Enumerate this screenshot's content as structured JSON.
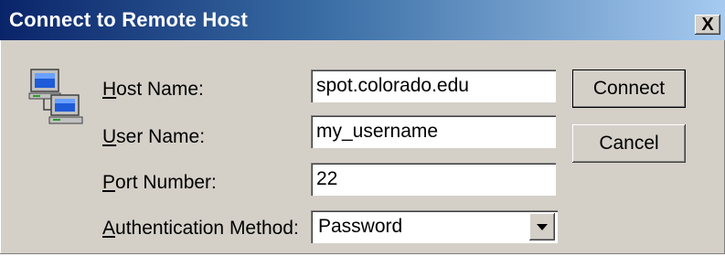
{
  "window": {
    "title": "Connect to Remote Host",
    "close_glyph": "X"
  },
  "icon": {
    "name": "network-computers-icon"
  },
  "form": {
    "host": {
      "label_accel": "H",
      "label_rest": "ost Name:",
      "value": "spot.colorado.edu"
    },
    "user": {
      "label_accel": "U",
      "label_rest": "ser Name:",
      "value": "my_username"
    },
    "port": {
      "label_accel": "P",
      "label_rest": "ort Number:",
      "value": "22"
    },
    "auth": {
      "label_accel": "A",
      "label_rest": "uthentication Method:",
      "value": "Password"
    }
  },
  "buttons": {
    "connect": "Connect",
    "cancel": "Cancel"
  },
  "colors": {
    "titlebar_start": "#0a246a",
    "titlebar_end": "#a6caf0",
    "dialog_bg": "#d4d0c8"
  }
}
